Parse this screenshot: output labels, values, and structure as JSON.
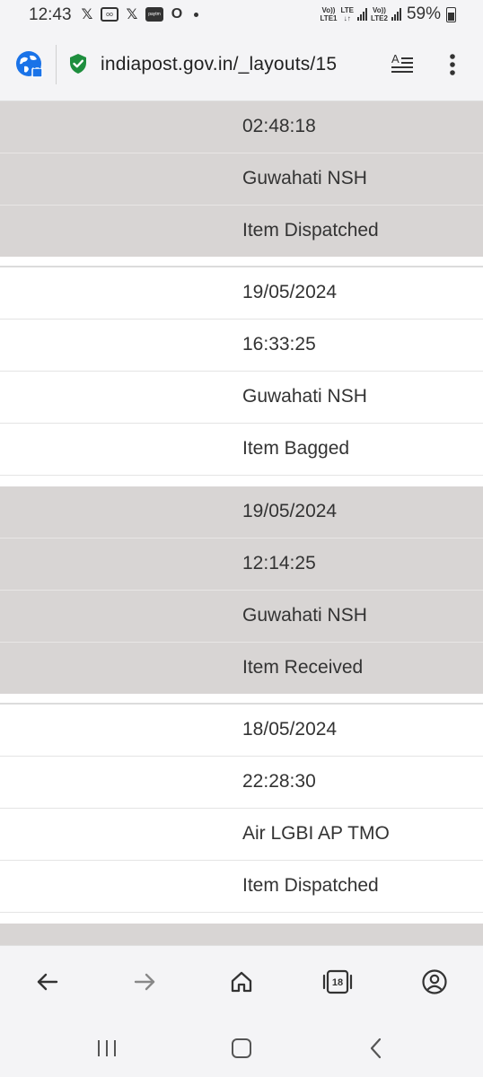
{
  "status_bar": {
    "time": "12:43",
    "icons": [
      "x-icon",
      "voicemail-icon",
      "x-icon",
      "paytm-icon",
      "opera-icon",
      "dot-icon"
    ],
    "net1_label": "Vo)) LTE1",
    "net_lte_label": "LTE",
    "net2_label": "Vo)) LTE2",
    "battery_percent": "59%"
  },
  "browser": {
    "url": "indiapost.gov.in/_layouts/15"
  },
  "tracking_rows": [
    {
      "shaded": true,
      "partial_top": true,
      "values": [
        "02:48:18",
        "Guwahati NSH",
        "Item Dispatched"
      ]
    },
    {
      "shaded": false,
      "values": [
        "19/05/2024",
        "16:33:25",
        "Guwahati NSH",
        "Item Bagged"
      ]
    },
    {
      "shaded": true,
      "values": [
        "19/05/2024",
        "12:14:25",
        "Guwahati NSH",
        "Item Received"
      ]
    },
    {
      "shaded": false,
      "values": [
        "18/05/2024",
        "22:28:30",
        "Air LGBI AP TMO",
        "Item Dispatched"
      ]
    }
  ],
  "bottom_nav": {
    "tab_count": "18"
  },
  "colors": {
    "shaded_row": "#d8d5d4",
    "secure_green": "#1e8e3e",
    "site_icon_blue": "#1a73e8"
  }
}
